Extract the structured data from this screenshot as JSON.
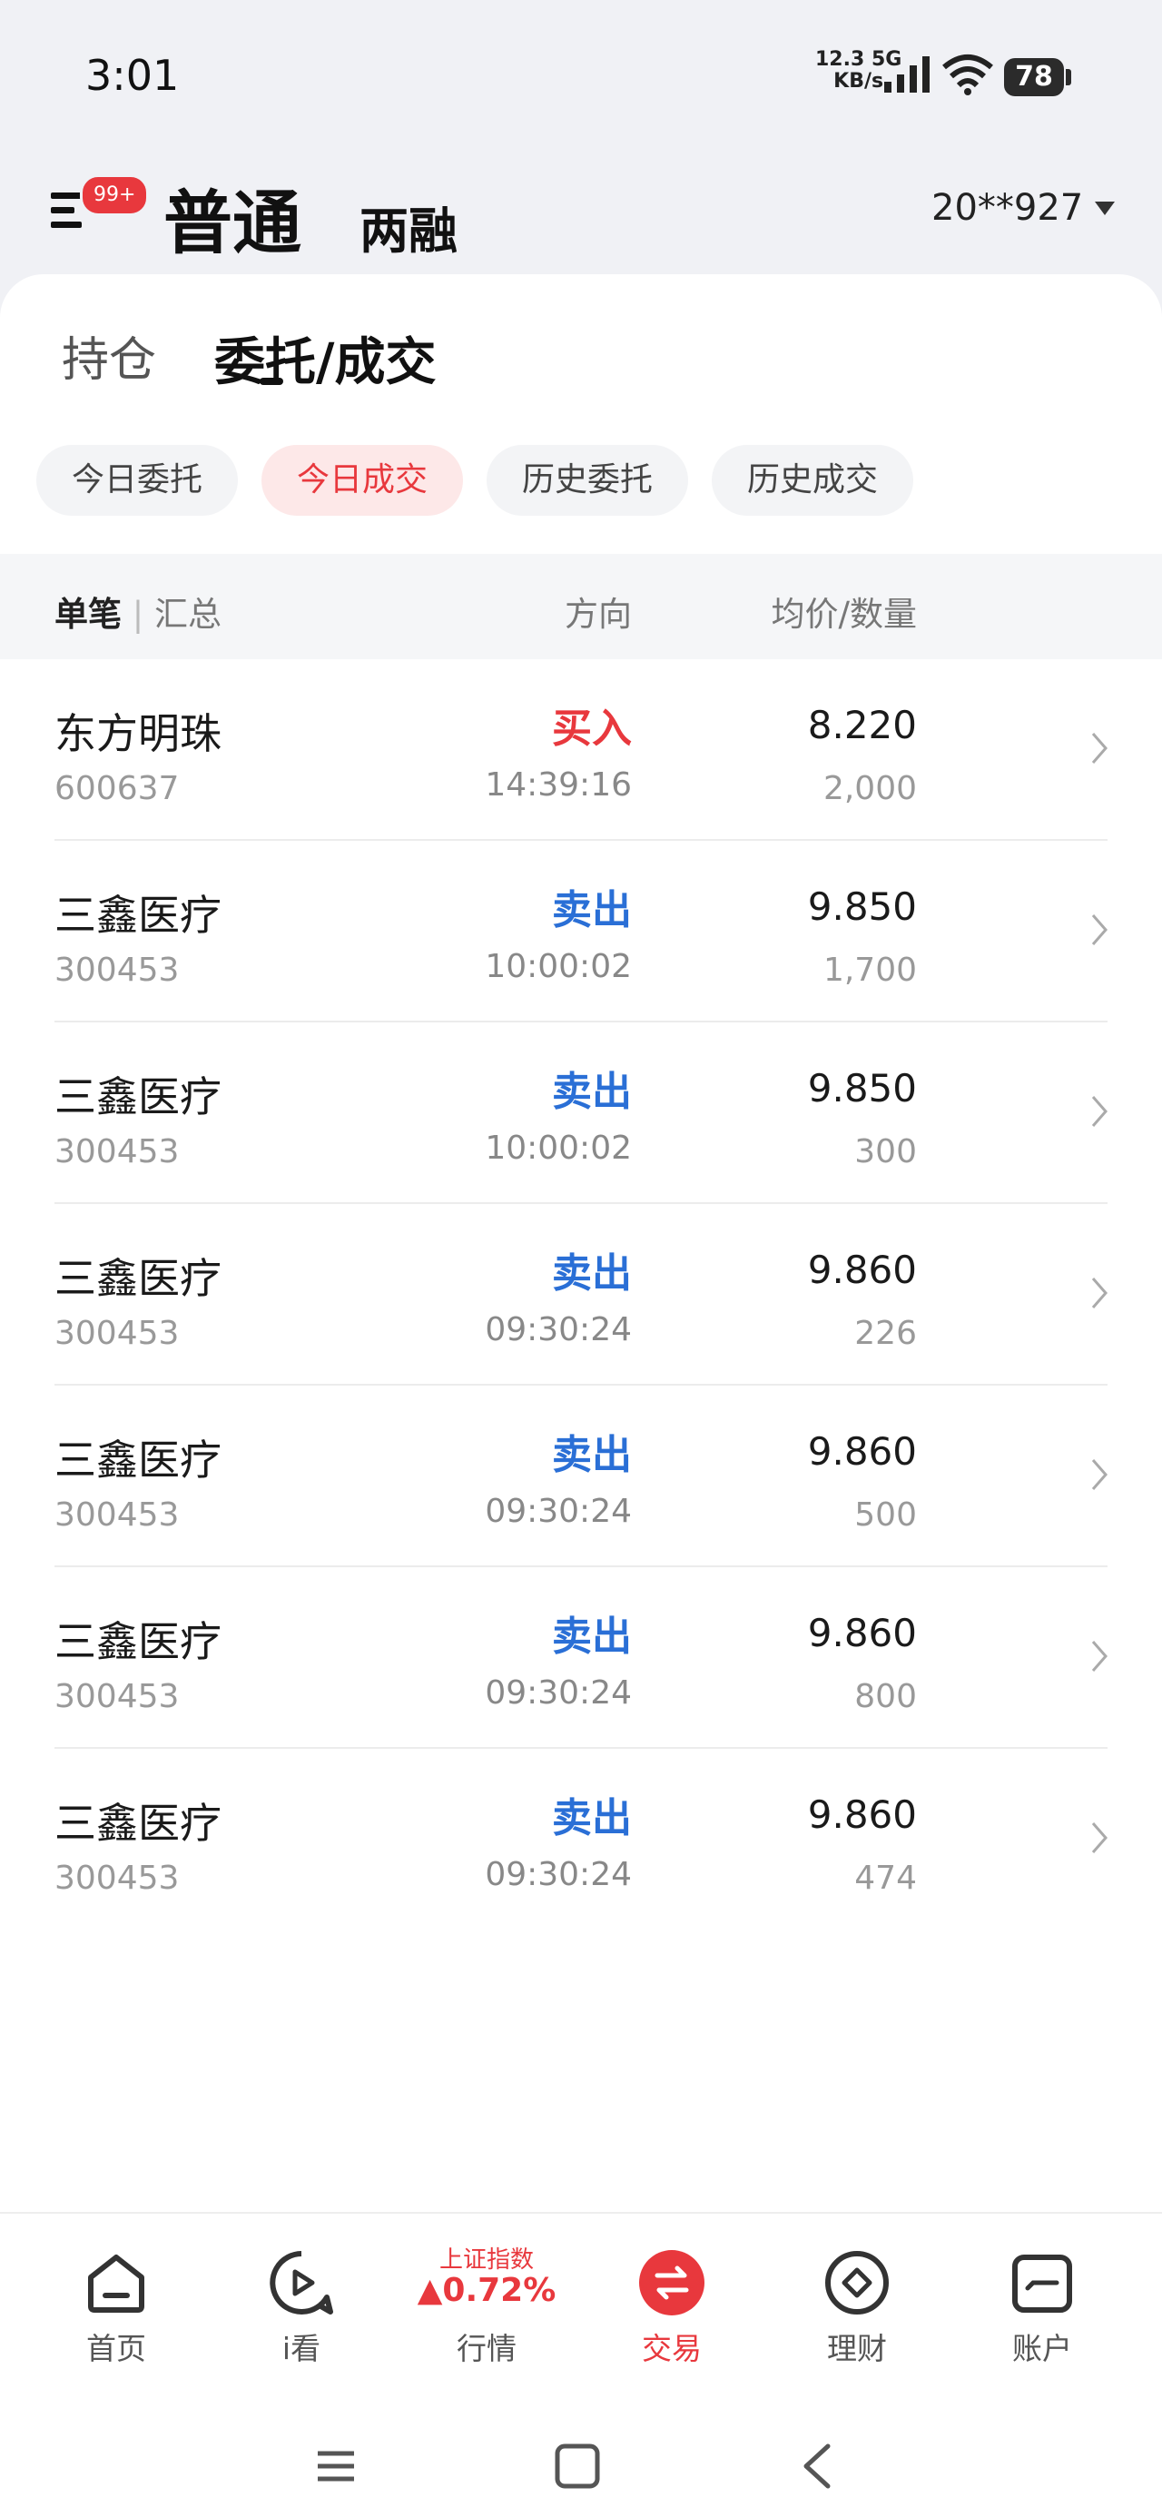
{
  "status_bar": {
    "time": "3:01",
    "net_speed_value": "12.3 5G",
    "net_speed_unit": "KB/s",
    "battery": "78"
  },
  "header": {
    "badge": "99+",
    "tab_main": "普通",
    "tab_sub": "两融",
    "account": "20**927"
  },
  "sub_tabs": {
    "holdings": "持仓",
    "orders": "委托/成交"
  },
  "chips": [
    "今日委托",
    "今日成交",
    "历史委托",
    "历史成交"
  ],
  "table_head": {
    "single": "单笔",
    "sep": " | ",
    "summary": "汇总",
    "direction": "方向",
    "price_qty": "均价/数量"
  },
  "rows": [
    {
      "name": "东方明珠",
      "code": "600637",
      "direction": "买入",
      "time": "14:39:16",
      "price": "8.220",
      "qty": "2,000"
    },
    {
      "name": "三鑫医疗",
      "code": "300453",
      "direction": "卖出",
      "time": "10:00:02",
      "price": "9.850",
      "qty": "1,700"
    },
    {
      "name": "三鑫医疗",
      "code": "300453",
      "direction": "卖出",
      "time": "10:00:02",
      "price": "9.850",
      "qty": "300"
    },
    {
      "name": "三鑫医疗",
      "code": "300453",
      "direction": "卖出",
      "time": "09:30:24",
      "price": "9.860",
      "qty": "226"
    },
    {
      "name": "三鑫医疗",
      "code": "300453",
      "direction": "卖出",
      "time": "09:30:24",
      "price": "9.860",
      "qty": "500"
    },
    {
      "name": "三鑫医疗",
      "code": "300453",
      "direction": "卖出",
      "time": "09:30:24",
      "price": "9.860",
      "qty": "800"
    },
    {
      "name": "三鑫医疗",
      "code": "300453",
      "direction": "卖出",
      "time": "09:30:24",
      "price": "9.860",
      "qty": "474"
    }
  ],
  "bottom_nav": {
    "home": "首页",
    "watch": "i看",
    "market_title": "上证指数",
    "market_value": "▲0.72%",
    "market": "行情",
    "trade": "交易",
    "finance": "理财",
    "account": "账户"
  },
  "colors": {
    "accent_red": "#e8383d",
    "sell_blue": "#2a6fd6"
  }
}
